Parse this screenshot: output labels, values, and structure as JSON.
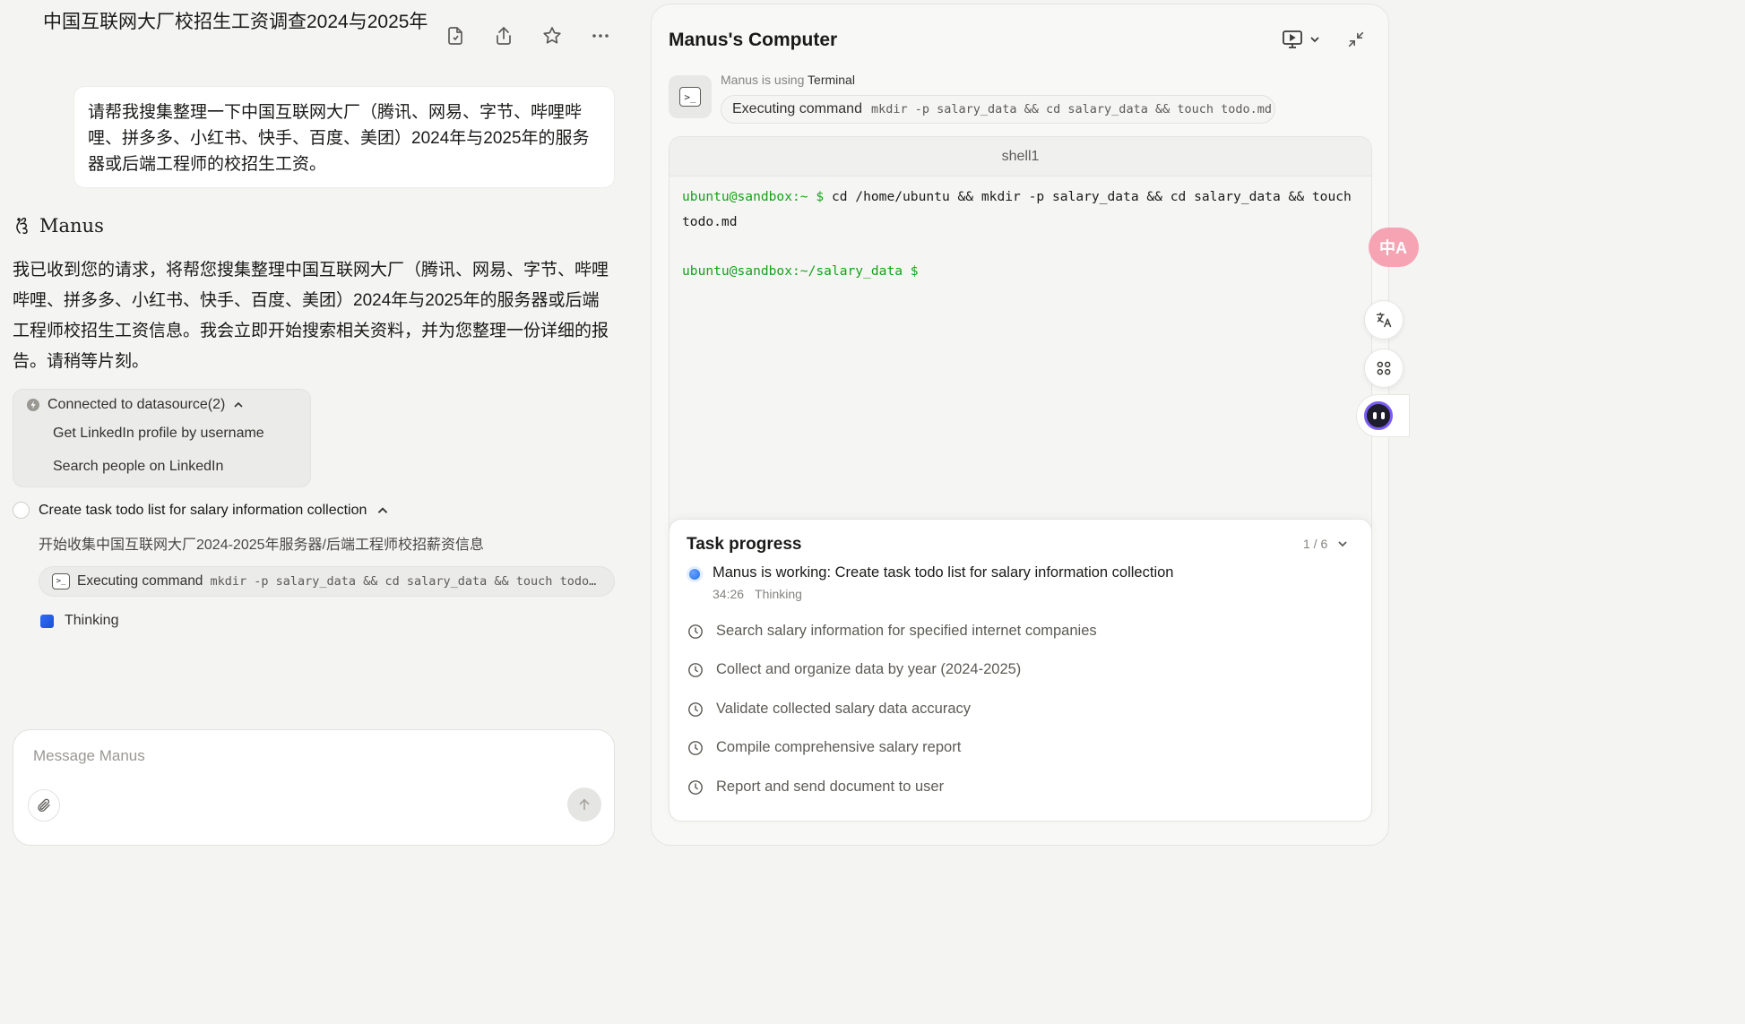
{
  "chat": {
    "title": "中国互联网大厂校招生工资调查2024与2025年",
    "user_message": "请帮我搜集整理一下中国互联网大厂（腾讯、网易、字节、哔哩哔哩、拼多多、小红书、快手、百度、美团）2024年与2025年的服务器或后端工程师的校招生工资。",
    "agent_name": "Manus",
    "agent_message": "我已收到您的请求，将帮您搜集整理中国互联网大厂（腾讯、网易、字节、哔哩哔哩、拼多多、小红书、快手、百度、美团）2024年与2025年的服务器或后端工程师校招生工资信息。我会立即开始搜索相关资料，并为您整理一份详细的报告。请稍等片刻。",
    "datasource": {
      "label": "Connected to datasource(2)",
      "items": [
        "Get LinkedIn profile by username",
        "Search people on LinkedIn"
      ]
    },
    "step": {
      "title": "Create task todo list for salary information collection",
      "subtitle": "开始收集中国互联网大厂2024-2025年服务器/后端工程师校招薪资信息",
      "exec_label": "Executing command",
      "exec_command": "mkdir -p salary_data && cd salary_data && touch todo.md"
    },
    "thinking_label": "Thinking",
    "composer_placeholder": "Message Manus"
  },
  "computer": {
    "title": "Manus's Computer",
    "using_prefix": "Manus is using",
    "using_tool": "Terminal",
    "exec_label": "Executing command",
    "exec_command": "mkdir -p salary_data && cd salary_data && touch todo.md",
    "shell_tab": "shell1",
    "shell": {
      "prompt1": "ubuntu@sandbox:~ $",
      "cmd1": " cd /home/ubuntu && mkdir -p salary_data && cd salary_data && touch todo.md",
      "prompt2": "ubuntu@sandbox:~/salary_data $"
    }
  },
  "task_progress": {
    "title": "Task progress",
    "count": "1 / 6",
    "active": {
      "label": "Manus is working: Create task todo list for salary information collection",
      "time": "34:26",
      "status": "Thinking"
    },
    "pending": [
      "Search salary information for specified internet companies",
      "Collect and organize data by year (2024-2025)",
      "Validate collected salary data accuracy",
      "Compile comprehensive salary report",
      "Report and send document to user"
    ]
  },
  "floating": {
    "translate_badge": "中A",
    "icons": [
      "translate-icon",
      "apps-icon",
      "assistant-bot-icon"
    ]
  },
  "colors": {
    "accent_blue": "#1f6feb",
    "prompt_green": "#15a318",
    "translate_pink": "#f6a3b4",
    "bot_purple": "#7b5cf5"
  }
}
